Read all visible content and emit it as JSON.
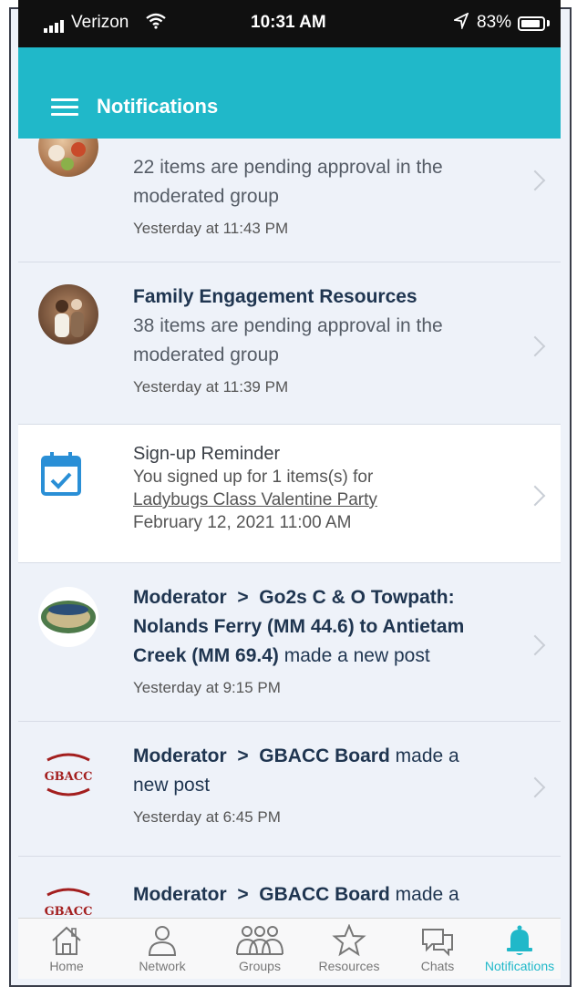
{
  "status_bar": {
    "carrier": "Verizon",
    "time": "10:31 AM",
    "battery": "83%"
  },
  "header": {
    "title": "Notifications"
  },
  "notifications": [
    {
      "line1": "22 items are pending approval in the",
      "line2": "moderated group",
      "time": "Yesterday at 11:43 PM"
    },
    {
      "title": "Family Engagement Resources",
      "line1": "38 items are pending approval in the",
      "line2": "moderated group",
      "time": "Yesterday at 11:39 PM"
    },
    {
      "title": "Sign-up Reminder",
      "line1": "You signed up for 1 items(s) for",
      "link": "Ladybugs Class Valentine Party",
      "date": "February 12, 2021 11:00 AM"
    },
    {
      "role": "Moderator",
      "sep": ">",
      "group_a": "Go2s C & O Towpath:",
      "group_b": "Nolands Ferry (MM 44.6) to Antietam",
      "group_c": "Creek (MM 69.4)",
      "action": "made a new post",
      "time": "Yesterday at 9:15 PM",
      "logo_text": "C&O CANAL"
    },
    {
      "role": "Moderator",
      "sep": ">",
      "group": "GBACC Board",
      "action_a": "made a",
      "action_b": "new post",
      "time": "Yesterday at 6:45 PM",
      "logo_text": "GBACC"
    },
    {
      "role": "Moderator",
      "sep": ">",
      "group": "GBACC Board",
      "action_a": "made a",
      "logo_text": "GBACC"
    }
  ],
  "tabs": [
    {
      "label": "Home",
      "icon": "home-icon"
    },
    {
      "label": "Network",
      "icon": "person-icon"
    },
    {
      "label": "Groups",
      "icon": "groups-icon"
    },
    {
      "label": "Resources",
      "icon": "star-icon"
    },
    {
      "label": "Chats",
      "icon": "chat-icon"
    },
    {
      "label": "Notifications",
      "icon": "bell-icon",
      "active": true
    }
  ],
  "colors": {
    "accent": "#20b8c9",
    "header_bg": "#20b8c9",
    "title_text": "#1f3550",
    "calendar_blue": "#2a8fd6"
  }
}
